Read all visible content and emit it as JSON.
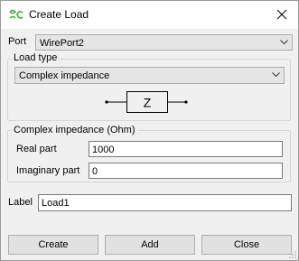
{
  "window": {
    "title": "Create Load",
    "icons": {
      "app": "app-logo-icon",
      "close": "close-icon"
    }
  },
  "port": {
    "label": "Port",
    "selected": "WirePort2"
  },
  "load_type": {
    "group_title": "Load type",
    "selected": "Complex impedance",
    "diagram_symbol": "Z"
  },
  "complex_impedance": {
    "group_title": "Complex impedance (Ohm)",
    "real_label": "Real part",
    "real_value": "1000",
    "imag_label": "Imaginary part",
    "imag_value": "0"
  },
  "label_field": {
    "label": "Label",
    "value": "Load1"
  },
  "buttons": {
    "create": "Create",
    "add": "Add",
    "close": "Close"
  },
  "colors": {
    "titlebar_bg": "#ffffff",
    "dialog_bg": "#f0f0f0",
    "icon_green": "#4caf50",
    "field_border": "#7a7a7a",
    "combo_bg": "#e5e5e5",
    "button_bg": "#e1e1e1"
  }
}
